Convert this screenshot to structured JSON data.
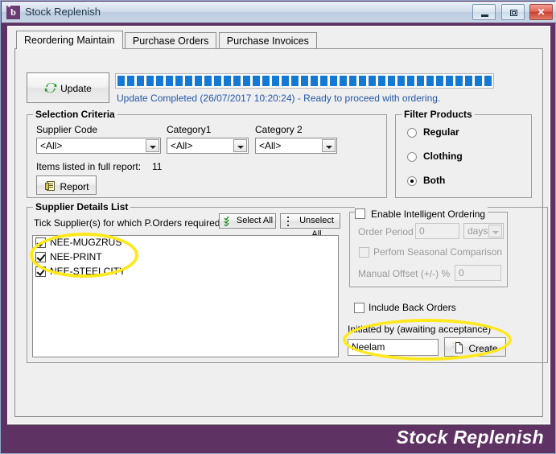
{
  "window": {
    "title": "Stock Replenish",
    "icon": "app-b-icon",
    "buttons": {
      "minimize": "minimize-button",
      "restore": "restore-button",
      "close": "close-button",
      "close_glyph": "✕"
    }
  },
  "tabs": [
    {
      "label": "Reordering Maintain",
      "active": true
    },
    {
      "label": "Purchase Orders",
      "active": false
    },
    {
      "label": "Purchase Invoices",
      "active": false
    }
  ],
  "toolbar": {
    "update_label": "Update",
    "progress_percent": 100,
    "status_text": "Update Completed (26/07/2017 10:20:24) - Ready to proceed with ordering.",
    "status_color": "#2255a8",
    "progress_color": "#1479d4"
  },
  "selection_criteria": {
    "legend": "Selection Criteria",
    "supplier_code_label": "Supplier Code",
    "supplier_code_value": "<All>",
    "category1_label": "Category1",
    "category1_value": "<All>",
    "category2_label": "Category 2",
    "category2_value": "<All>",
    "items_label": "Items listed in full report:",
    "items_count": "11",
    "report_label": "Report"
  },
  "filter_products": {
    "legend": "Filter Products",
    "options": [
      {
        "label": "Regular",
        "selected": false
      },
      {
        "label": "Clothing",
        "selected": false
      },
      {
        "label": "Both",
        "selected": true
      }
    ]
  },
  "supplier_details": {
    "legend": "Supplier Details List",
    "instruction": "Tick Supplier(s) for which P.Orders required:",
    "select_all_label": "Select All",
    "unselect_all_label": "Unselect All",
    "suppliers": [
      {
        "name": "NEE-MUGZRUS",
        "checked": true
      },
      {
        "name": "NEE-PRINT",
        "checked": true
      },
      {
        "name": "NEE-STEELCITY",
        "checked": true
      }
    ]
  },
  "intelligent_ordering": {
    "enable_label": "Enable Intelligent Ordering",
    "enabled": false,
    "order_period_label": "Order Period",
    "order_period_value": "0",
    "order_period_unit": "days",
    "seasonal_label": "Perfom Seasonal Comparison",
    "seasonal_checked": false,
    "manual_offset_label": "Manual Offset (+/-) %",
    "manual_offset_value": "0",
    "include_back_orders_label": "Include Back Orders",
    "include_back_orders_checked": false
  },
  "initiated_by": {
    "label": "Initiated by (awaiting acceptance)",
    "name_value": "Neelam",
    "create_label": "Create"
  },
  "footer": {
    "brand": "Stock Replenish",
    "background": "#5e3263"
  },
  "highlight_color": "#ffe81c"
}
